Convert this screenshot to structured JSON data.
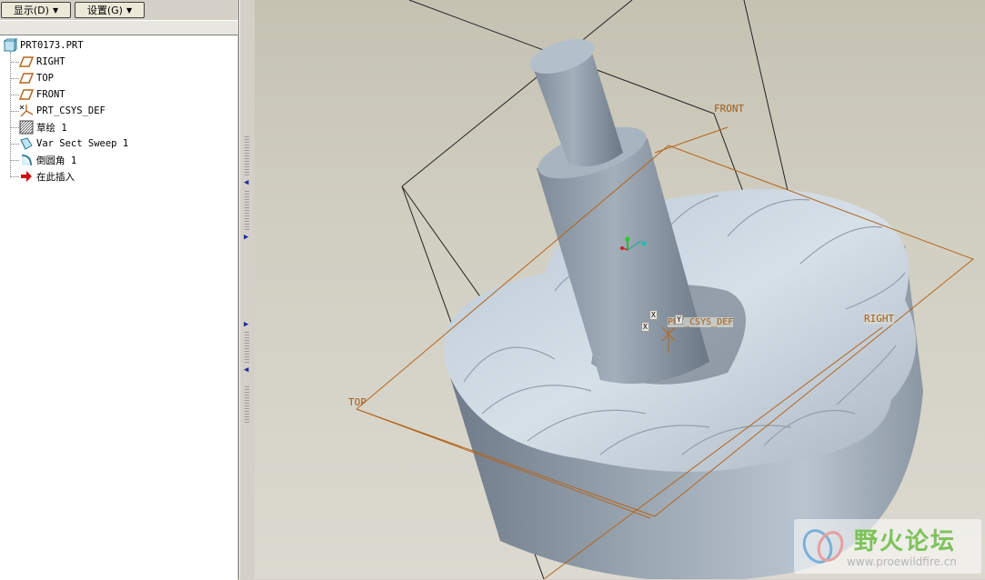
{
  "toolbar": {
    "display_label": "显示(D)",
    "settings_label": "设置(G)"
  },
  "tree": {
    "items": [
      {
        "label": "PRT0173.PRT",
        "icon": "part-icon"
      },
      {
        "label": "RIGHT",
        "icon": "datum-plane-icon"
      },
      {
        "label": "TOP",
        "icon": "datum-plane-icon"
      },
      {
        "label": "FRONT",
        "icon": "datum-plane-icon"
      },
      {
        "label": "PRT_CSYS_DEF",
        "icon": "coordinate-system-icon"
      },
      {
        "label": "草绘 1",
        "icon": "sketch-icon"
      },
      {
        "label": "Var Sect Sweep 1",
        "icon": "sweep-icon"
      },
      {
        "label": "倒圆角 1",
        "icon": "round-icon"
      },
      {
        "label": "在此插入",
        "icon": "insert-here-icon"
      }
    ]
  },
  "viewport": {
    "datum_labels": {
      "front": "FRONT",
      "top": "TOP",
      "right": "RIGHT",
      "csys": "PRT_CSYS_DEF",
      "axis_x1": "X",
      "axis_x2": "X",
      "axis_y": "Y"
    }
  },
  "watermark": {
    "title": "野火论坛",
    "url": "www.proewildfire.cn"
  },
  "colors": {
    "datum_plane": "#b5651d",
    "part_grey": "#a8b3bf",
    "viewport_bg": "#d1cfc2",
    "watermark_green": "#7dc25a"
  }
}
